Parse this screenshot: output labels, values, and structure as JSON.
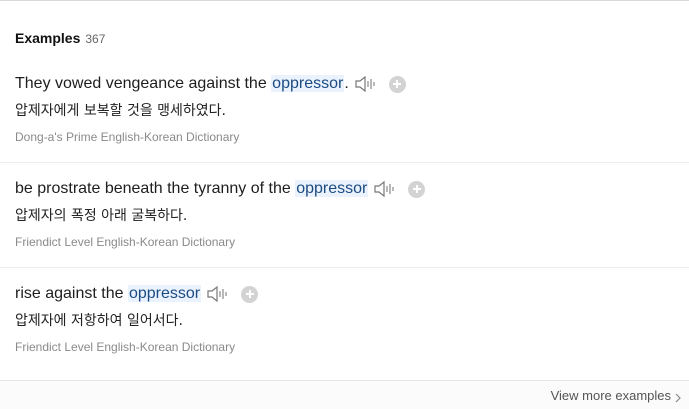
{
  "header": {
    "title": "Examples",
    "count": "367"
  },
  "examples": [
    {
      "before": "They vowed vengeance against the ",
      "highlight": "oppressor",
      "after": ".",
      "translation": "압제자에게 보복할 것을 맹세하였다.",
      "source": "Dong-a's Prime English-Korean Dictionary"
    },
    {
      "before": "be prostrate beneath the tyranny of the ",
      "highlight": "oppressor",
      "after": "",
      "translation": "압제자의 폭정 아래 굴복하다.",
      "source": "Friendict Level English-Korean Dictionary"
    },
    {
      "before": "rise against the ",
      "highlight": "oppressor",
      "after": "",
      "translation": "압제자에 저항하여 일어서다.",
      "source": "Friendict Level English-Korean Dictionary"
    }
  ],
  "footer": {
    "view_more_label": "View more examples"
  },
  "icons": {
    "audio": "speaker-icon",
    "add": "plus-circle-icon",
    "more": "chevron-right-icon"
  },
  "colors": {
    "highlight_bg": "#eaf3fd",
    "highlight_text": "#1c4b82",
    "source_text": "#8a8a8a"
  }
}
